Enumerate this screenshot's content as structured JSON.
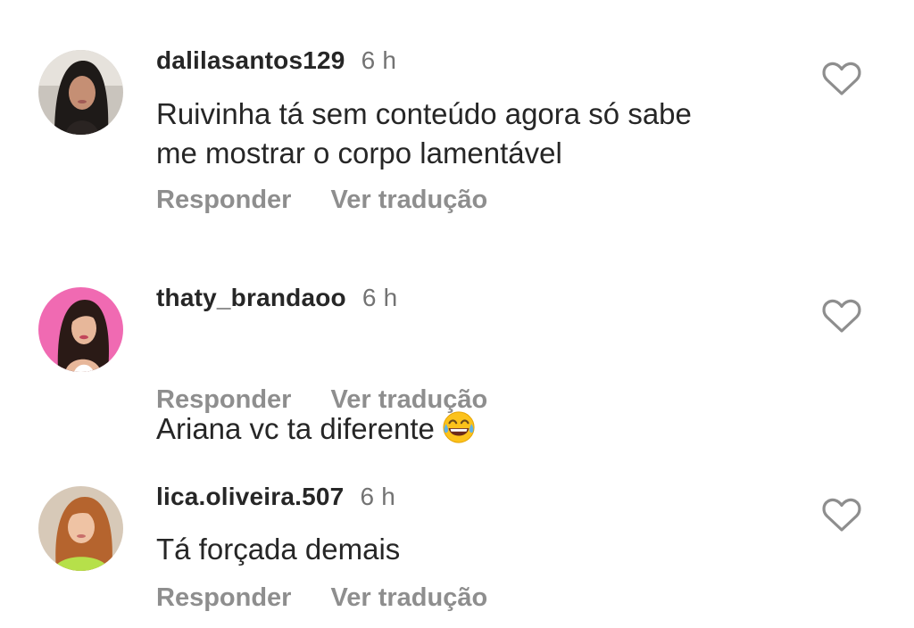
{
  "comments": [
    {
      "username": "dalilasantos129",
      "time": "6 h",
      "text": "Ruivinha tá sem conteúdo agora só sabe\nme mostrar o corpo lamentável",
      "reply_label": "Responder",
      "translate_label": "Ver tradução"
    },
    {
      "username": "thaty_brandaoo",
      "time": "6 h",
      "text": "Ariana vc ta diferente",
      "emoji": "grinning-sweat-face-icon",
      "reply_label": "Responder",
      "translate_label": "Ver tradução"
    },
    {
      "username": "lica.oliveira.507",
      "time": "6 h",
      "text": "Tá forçada demais",
      "reply_label": "Responder",
      "translate_label": "Ver tradução"
    }
  ],
  "colors": {
    "text": "#262626",
    "secondary": "#8e8e8e",
    "avatar_bg_pink": "#f06ab2"
  }
}
